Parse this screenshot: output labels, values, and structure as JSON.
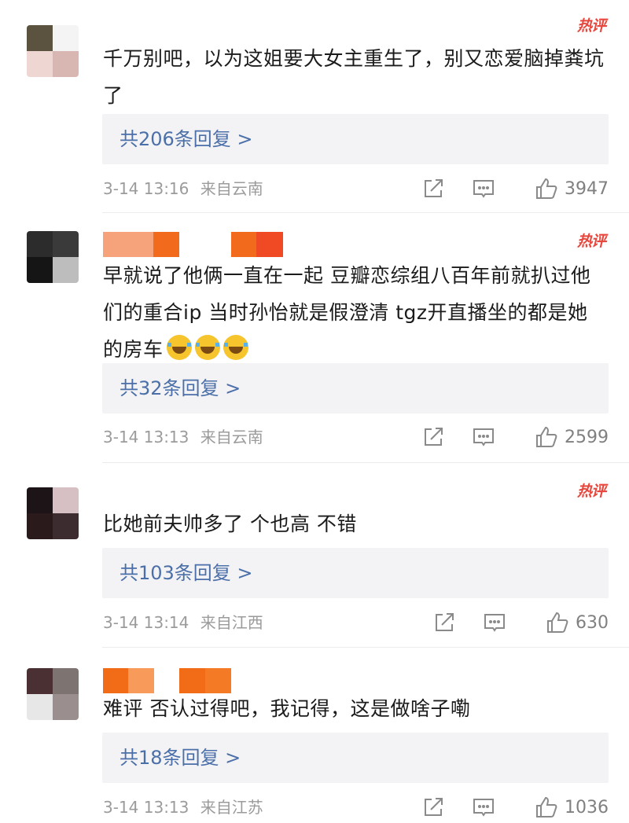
{
  "hot_label": "热评",
  "comments": [
    {
      "text": "千万别吧，以为这姐要大女主重生了，别又恋爱脑掉粪坑了",
      "replies_label": "共206条回复 >",
      "time": "3-14 13:16",
      "location": "来自云南",
      "likes": "3947",
      "avatar_colors": [
        "#5b5340",
        "#ffffff",
        "#eed6d2",
        "#d8b6b2"
      ]
    },
    {
      "text": "早就说了他俩一直在一起 豆瓣恋综组八百年前就扒过他们的重合ip 当时孙怡就是假澄清 tgz开直播坐的都是她的房车",
      "replies_label": "共32条回复 >",
      "time": "3-14 13:13",
      "location": "来自云南",
      "likes": "2599",
      "avatar_colors": [
        "#2c2c2c",
        "#3a3a3a",
        "#151515",
        "#c8c8c8"
      ],
      "name_colors": [
        "#f6a27a",
        "#f26a1b",
        "#ffffff",
        "#f04a25"
      ]
    },
    {
      "text": "比她前夫帅多了 个也高 不错",
      "replies_label": "共103条回复 >",
      "time": "3-14 13:14",
      "location": "来自江西",
      "likes": "630",
      "avatar_colors": [
        "#1c1416",
        "#d6c0c4",
        "#2a1a1c",
        "#3c2c30"
      ]
    },
    {
      "text": "难评 否认过得吧，我记得，这是做啥子嘞",
      "replies_label": "共18条回复 >",
      "time": "3-14 13:13",
      "location": "来自江苏",
      "likes": "1036",
      "avatar_colors": [
        "#4a3033",
        "#7d7472",
        "#e7e7e7",
        "#9a8f8e"
      ],
      "name_colors": [
        "#f47a25",
        "#f79a5a",
        "#ffffff",
        "#f26b17"
      ]
    }
  ]
}
